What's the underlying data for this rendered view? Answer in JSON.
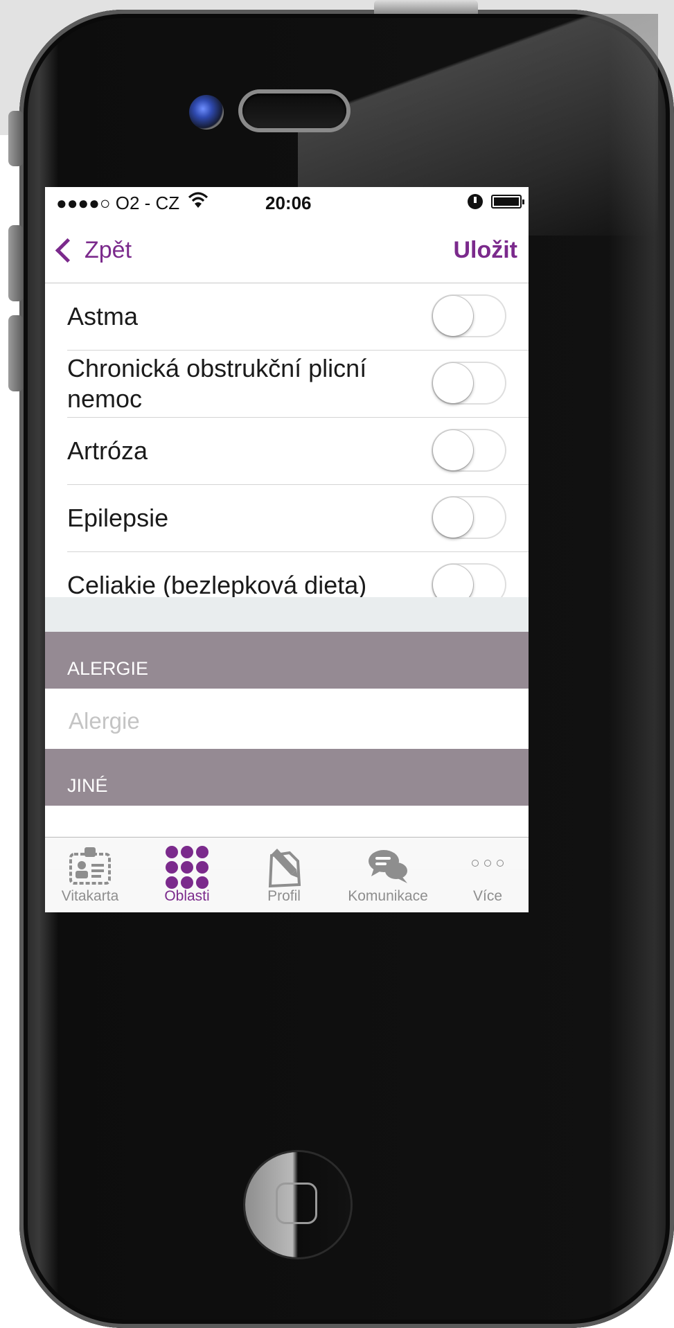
{
  "status_bar": {
    "carrier": "●●●●○ O2 - CZ",
    "time": "20:06",
    "wifi_icon": "wifi-icon",
    "alarm_icon": "alarm-icon",
    "battery_icon": "battery-icon"
  },
  "nav": {
    "back_label": "Zpět",
    "save_label": "Uložit"
  },
  "conditions": [
    {
      "label": "Astma",
      "on": false
    },
    {
      "label": "Chronická obstrukční plicní nemoc",
      "on": false
    },
    {
      "label": "Artróza",
      "on": false
    },
    {
      "label": "Epilepsie",
      "on": false
    },
    {
      "label": "Celiakie (bezlepková dieta)",
      "on": false
    }
  ],
  "allergies": {
    "header": "ALERGIE",
    "placeholder": "Alergie",
    "value": ""
  },
  "other": {
    "header": "JINÉ",
    "placeholder": "",
    "value": ""
  },
  "tabs": [
    {
      "label": "Vitakarta",
      "icon": "id-card-icon",
      "active": false
    },
    {
      "label": "Oblasti",
      "icon": "grid-dots-icon",
      "active": true
    },
    {
      "label": "Profil",
      "icon": "edit-document-icon",
      "active": false
    },
    {
      "label": "Komunikace",
      "icon": "chat-bubbles-icon",
      "active": false
    },
    {
      "label": "Více",
      "icon": "more-icon",
      "active": false
    }
  ],
  "colors": {
    "accent": "#7b2a8c",
    "section_header": "#958a93",
    "section_gap": "#e9edee"
  }
}
